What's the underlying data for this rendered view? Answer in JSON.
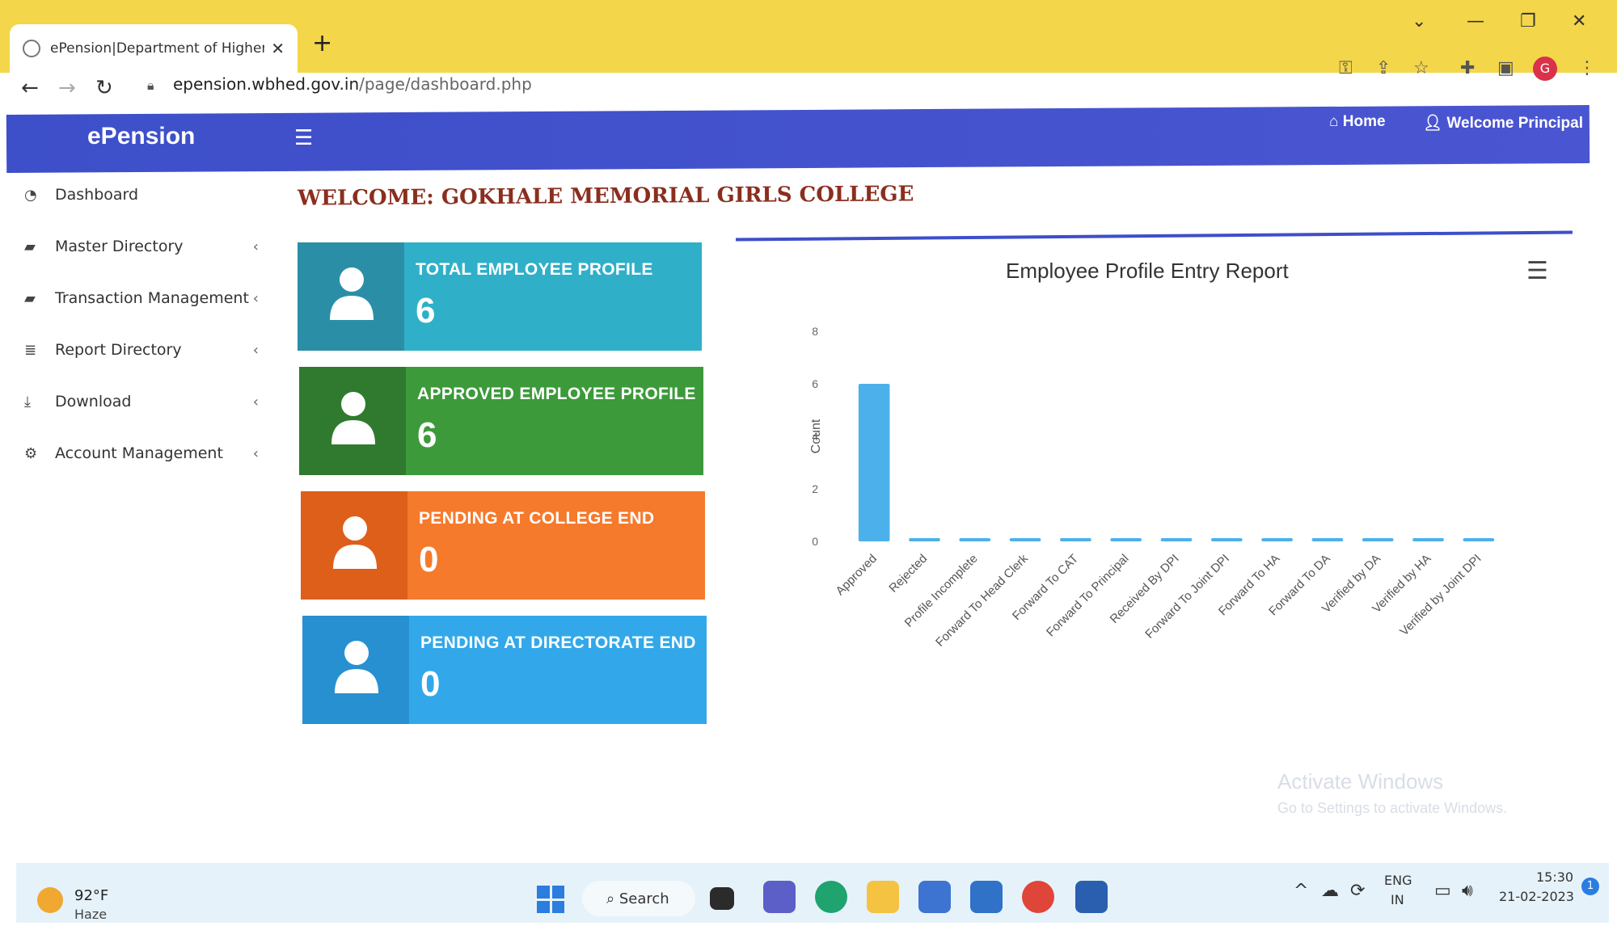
{
  "browser": {
    "tab_title": "ePension|Department of Higher",
    "new_tab": "+",
    "url_host": "epension.wbhed.gov.in",
    "url_path": "/page/dashboard.php"
  },
  "header": {
    "brand": "ePension",
    "home_label": "Home",
    "welcome_label": "Welcome Principal"
  },
  "sidebar": {
    "items": [
      {
        "label": "Dashboard",
        "icon": "dashboard-icon",
        "has_chevron": false
      },
      {
        "label": "Master Directory",
        "icon": "book-icon",
        "has_chevron": true
      },
      {
        "label": "Transaction Management",
        "icon": "book-icon",
        "has_chevron": true
      },
      {
        "label": "Report Directory",
        "icon": "database-icon",
        "has_chevron": true
      },
      {
        "label": "Download",
        "icon": "download-icon",
        "has_chevron": true
      },
      {
        "label": "Account Management",
        "icon": "gears-icon",
        "has_chevron": true
      }
    ]
  },
  "main": {
    "welcome": "WELCOME: GOKHALE MEMORIAL GIRLS COLLEGE",
    "cards": [
      {
        "label": "TOTAL EMPLOYEE PROFILE",
        "value": "6",
        "color": "#2fb0c8",
        "dark": "#2a8fa6"
      },
      {
        "label": "APPROVED EMPLOYEE PROFILE",
        "value": "6",
        "color": "#3c9a3a",
        "dark": "#2f7a2f"
      },
      {
        "label": "PENDING AT COLLEGE END",
        "value": "0",
        "color": "#f57a2c",
        "dark": "#dd5f1a"
      },
      {
        "label": "PENDING AT DIRECTORATE END",
        "value": "0",
        "color": "#32a8ea",
        "dark": "#2790d0"
      }
    ]
  },
  "chart_data": {
    "type": "bar",
    "title": "Employee Profile Entry Report",
    "ylabel": "Count",
    "xlabel": "",
    "ylim": [
      0,
      8
    ],
    "yticks": [
      0,
      2,
      4,
      6,
      8
    ],
    "categories": [
      "Approved",
      "Rejected",
      "Profile Incomplete",
      "Forward To Head Clerk",
      "Forward To CAT",
      "Forward To Principal",
      "Received By DPI",
      "Forward To Joint DPI",
      "Forward To HA",
      "Forward To DA",
      "Verified by DA",
      "Verified by HA",
      "Verified by Joint DPI"
    ],
    "values": [
      6,
      0,
      0,
      0,
      0,
      0,
      0,
      0,
      0,
      0,
      0,
      0,
      0
    ],
    "bar_color": "#4cb1ea",
    "grid": false
  },
  "watermark": {
    "line1": "Activate Windows",
    "line2": "Go to Settings to activate Windows."
  },
  "taskbar": {
    "temperature": "92°F",
    "weather": "Haze",
    "search": "Search",
    "lang1": "ENG",
    "lang2": "IN",
    "time": "15:30",
    "date": "21-02-2023",
    "notification_count": "1"
  }
}
